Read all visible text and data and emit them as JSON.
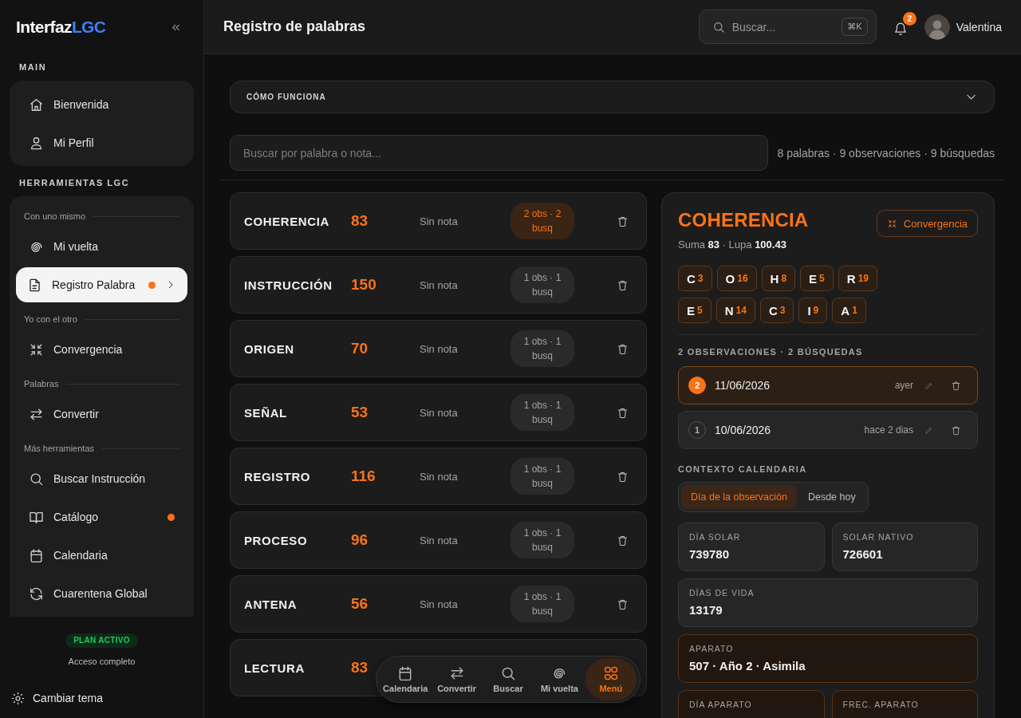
{
  "sidebar": {
    "logo": {
      "text": "Interfaz",
      "accent": "LGC"
    },
    "main": {
      "title": "MAIN",
      "items": [
        {
          "label": "Bienvenida",
          "selected": false,
          "dot": false
        },
        {
          "label": "Mi Perfil",
          "selected": false,
          "dot": false
        }
      ]
    },
    "tools": {
      "title": "HERRAMIENTAS LGC",
      "groups": [
        {
          "heading": "Con uno mismo",
          "items": [
            {
              "label": "Mi vuelta",
              "selected": false,
              "dot": false
            },
            {
              "label": "Registro Palabra",
              "selected": true,
              "dot": true
            }
          ]
        },
        {
          "heading": "Yo con el otro",
          "items": [
            {
              "label": "Convergencia",
              "selected": false,
              "dot": false
            }
          ]
        },
        {
          "heading": "Palabras",
          "items": [
            {
              "label": "Convertir",
              "selected": false,
              "dot": false
            }
          ]
        },
        {
          "heading": "Más herramientas",
          "items": [
            {
              "label": "Buscar Instrucción",
              "selected": false,
              "dot": false
            },
            {
              "label": "Catálogo",
              "selected": false,
              "dot": true
            },
            {
              "label": "Calendaria",
              "selected": false,
              "dot": false
            },
            {
              "label": "Cuarentena Global",
              "selected": false,
              "dot": false
            }
          ]
        }
      ]
    },
    "plan": {
      "badge": "PLAN ACTIVO",
      "text": "Acceso completo"
    },
    "theme_toggle": "Cambiar tema"
  },
  "header": {
    "title": "Registro de palabras",
    "search": {
      "placeholder": "Buscar...",
      "shortcut": "⌘K"
    },
    "notifications": "2",
    "user": "Valentina"
  },
  "how_it_works": {
    "title": "CÓMO FUNCIONA",
    "expanded": false
  },
  "filter": {
    "placeholder": "Buscar por palabra o nota...",
    "stats": "8 palabras · 9 observaciones · 9 búsquedas"
  },
  "words": [
    {
      "word": "COHERENCIA",
      "value": "83",
      "note": "Sin nota",
      "count": "2 obs · 2 busq",
      "selected": true
    },
    {
      "word": "INSTRUCCIÓN",
      "value": "150",
      "note": "Sin nota",
      "count": "1 obs · 1 busq",
      "selected": false
    },
    {
      "word": "ORIGEN",
      "value": "70",
      "note": "Sin nota",
      "count": "1 obs · 1 busq",
      "selected": false
    },
    {
      "word": "SEÑAL",
      "value": "53",
      "note": "Sin nota",
      "count": "1 obs · 1 busq",
      "selected": false
    },
    {
      "word": "REGISTRO",
      "value": "116",
      "note": "Sin nota",
      "count": "1 obs · 1 busq",
      "selected": false
    },
    {
      "word": "PROCESO",
      "value": "96",
      "note": "Sin nota",
      "count": "1 obs · 1 busq",
      "selected": false
    },
    {
      "word": "ANTENA",
      "value": "56",
      "note": "Sin nota",
      "count": "1 obs · 1 busq",
      "selected": false
    },
    {
      "word": "LECTURA",
      "value": "83"
    }
  ],
  "detail": {
    "title": "COHERENCIA",
    "action": "Convergencia",
    "summary": "Suma **83** · Lupa **100.43**",
    "letter_rows": [
      [
        {
          "letter": "C",
          "value": "3"
        },
        {
          "letter": "O",
          "value": "16"
        },
        {
          "letter": "H",
          "value": "8"
        },
        {
          "letter": "E",
          "value": "5"
        },
        {
          "letter": "R",
          "value": "19"
        }
      ],
      [
        {
          "letter": "E",
          "value": "5"
        },
        {
          "letter": "N",
          "value": "14"
        },
        {
          "letter": "C",
          "value": "3"
        },
        {
          "letter": "I",
          "value": "9"
        },
        {
          "letter": "A",
          "value": "1"
        }
      ]
    ],
    "observations_heading": "2 OBSERVACIONES · 2 BÚSQUEDAS",
    "observations": [
      {
        "number": "2",
        "date": "11/06/2026",
        "ago": "ayer",
        "selected": true
      },
      {
        "number": "1",
        "date": "10/06/2026",
        "ago": "hace 2 dias",
        "selected": false
      }
    ],
    "calendar_heading": "CONTEXTO CALENDARIA",
    "calendar_tabs": [
      {
        "label": "Día de la observación",
        "selected": true
      },
      {
        "label": "Desde hoy",
        "selected": false
      }
    ],
    "stat_rows": [
      [
        {
          "label": "DÍA SOLAR",
          "value": "739780",
          "highlighted": false
        },
        {
          "label": "SOLAR NATIVO",
          "value": "726601",
          "highlighted": false
        }
      ],
      [
        {
          "label": "DÍAS DE VIDA",
          "value": "13179",
          "highlighted": false
        }
      ],
      [
        {
          "label": "APARATO",
          "value": "507 · Año 2 · Asimila",
          "highlighted": true
        }
      ],
      [
        {
          "label": "DÍA APARATO",
          "highlighted": true
        },
        {
          "label": "FREC. APARATO",
          "highlighted": true
        }
      ]
    ]
  },
  "bottom_nav": [
    {
      "label": "Calendaria",
      "selected": false
    },
    {
      "label": "Convertir",
      "selected": false
    },
    {
      "label": "Buscar",
      "selected": false
    },
    {
      "label": "Mi vuelta",
      "selected": false
    },
    {
      "label": "Menú",
      "selected": true
    }
  ]
}
